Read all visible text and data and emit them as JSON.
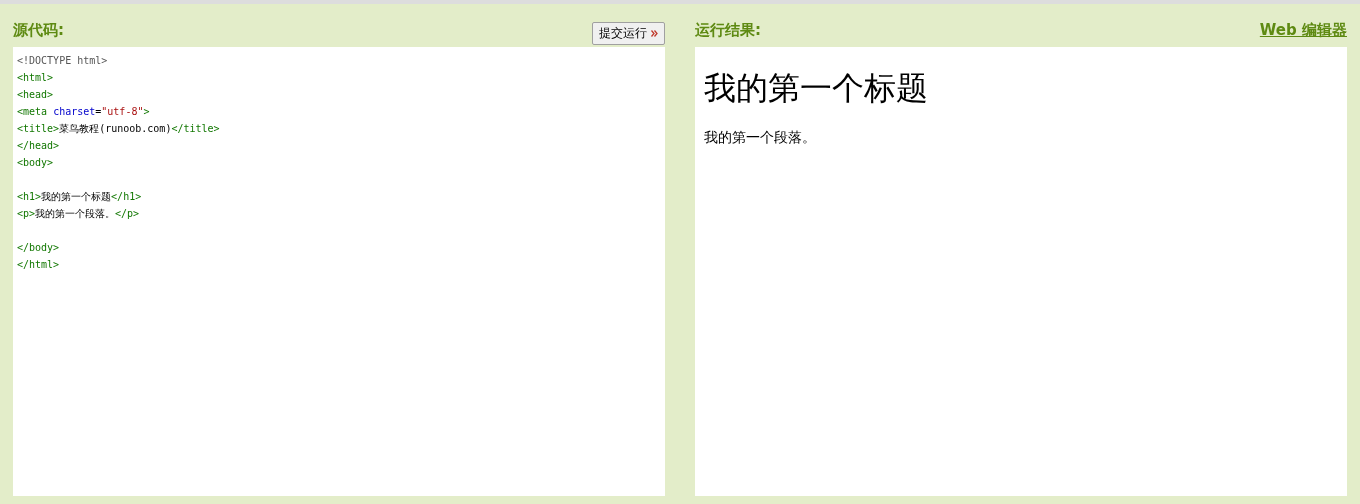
{
  "source_panel": {
    "title": "源代码:",
    "run_button": {
      "label": "提交运行"
    },
    "code_lines": [
      {
        "kind": "code",
        "tokens": [
          {
            "kind": "doctype",
            "text": "<!DOCTYPE html>"
          }
        ]
      },
      {
        "kind": "code",
        "tokens": [
          {
            "kind": "tag",
            "text": "<html>"
          }
        ]
      },
      {
        "kind": "code",
        "tokens": [
          {
            "kind": "tag",
            "text": "<head>"
          }
        ]
      },
      {
        "kind": "code",
        "tokens": [
          {
            "kind": "tag",
            "text": "<meta "
          },
          {
            "kind": "attr",
            "text": "charset"
          },
          {
            "kind": "text",
            "text": "="
          },
          {
            "kind": "value",
            "text": "\"utf-8\""
          },
          {
            "kind": "tag",
            "text": ">"
          }
        ]
      },
      {
        "kind": "code",
        "tokens": [
          {
            "kind": "tag",
            "text": "<title>"
          },
          {
            "kind": "text",
            "text": "菜鸟教程(runoob.com)"
          },
          {
            "kind": "tag",
            "text": "</title>"
          }
        ]
      },
      {
        "kind": "code",
        "tokens": [
          {
            "kind": "tag",
            "text": "</head>"
          }
        ]
      },
      {
        "kind": "code",
        "tokens": [
          {
            "kind": "tag",
            "text": "<body>"
          }
        ]
      },
      {
        "kind": "blank"
      },
      {
        "kind": "code",
        "tokens": [
          {
            "kind": "tag",
            "text": "<h1>"
          },
          {
            "kind": "text",
            "text": "我的第一个标题"
          },
          {
            "kind": "tag",
            "text": "</h1>"
          }
        ]
      },
      {
        "kind": "code",
        "tokens": [
          {
            "kind": "tag",
            "text": "<p>"
          },
          {
            "kind": "text",
            "text": "我的第一个段落。"
          },
          {
            "kind": "tag",
            "text": "</p>"
          }
        ]
      },
      {
        "kind": "blank"
      },
      {
        "kind": "code",
        "tokens": [
          {
            "kind": "tag",
            "text": "</body>"
          }
        ]
      },
      {
        "kind": "code",
        "tokens": [
          {
            "kind": "tag",
            "text": "</html>"
          }
        ]
      }
    ]
  },
  "result_panel": {
    "title": "运行结果:",
    "editor_link": "Web 编辑器",
    "heading": "我的第一个标题",
    "paragraph": "我的第一个段落。"
  }
}
